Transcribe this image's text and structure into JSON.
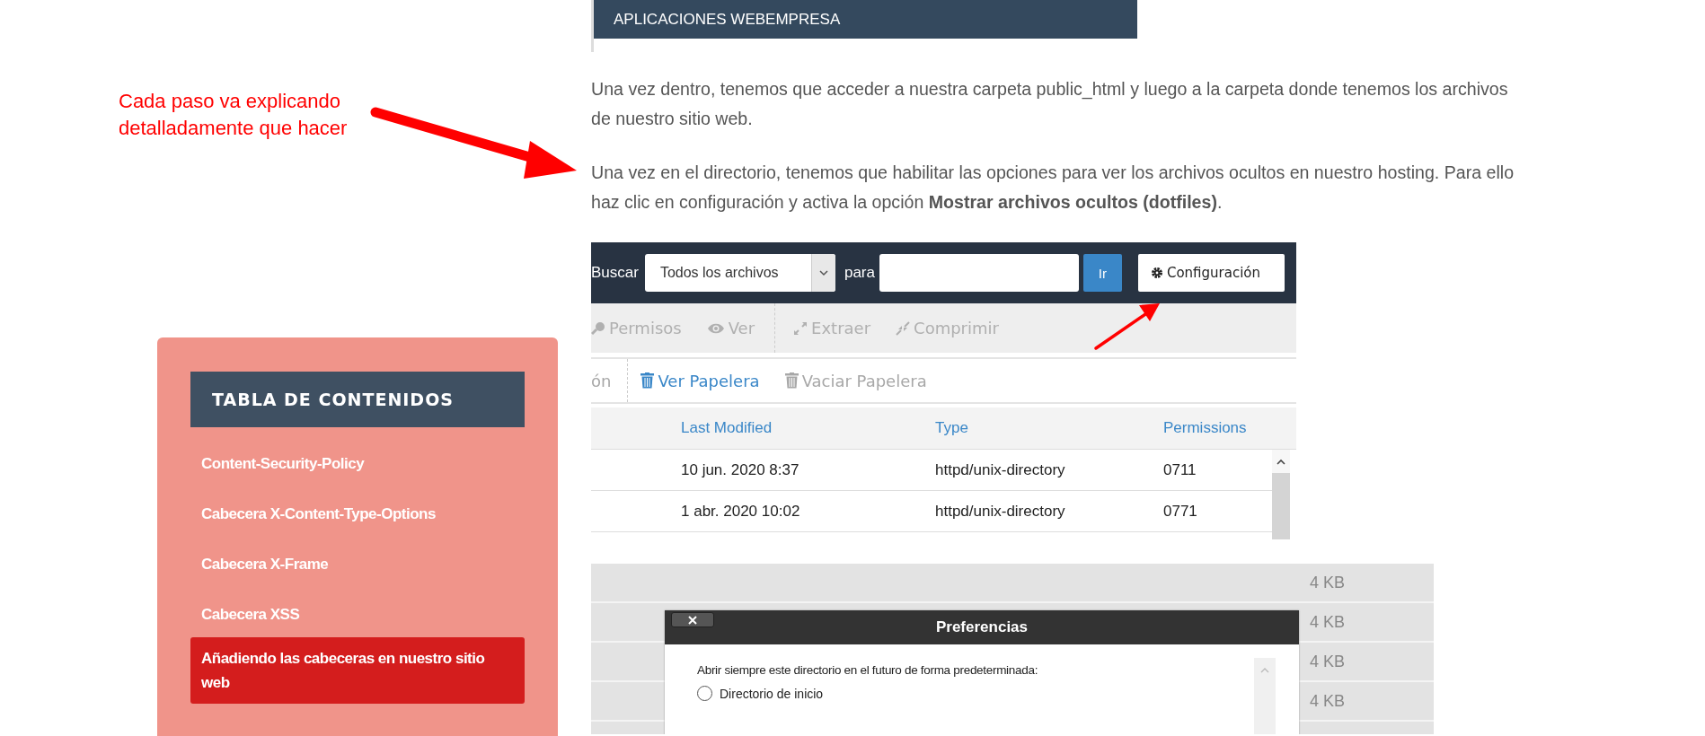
{
  "annotation": {
    "text": "Cada paso va explicando detalladamente que hacer"
  },
  "toc": {
    "title": "TABLA DE CONTENIDOS",
    "items": [
      {
        "label": "Content-Security-Policy",
        "selected": false
      },
      {
        "label": "Cabecera X-Content-Type-Options",
        "selected": false
      },
      {
        "label": "Cabecera X-Frame",
        "selected": false
      },
      {
        "label": "Cabecera XSS",
        "selected": false
      },
      {
        "label": "Añadiendo las cabeceras en nuestro sitio web",
        "selected": true
      }
    ]
  },
  "banner": {
    "title": "APLICACIONES WEBEMPRESA"
  },
  "paragraphs": [
    "Una vez dentro, tenemos que acceder a nuestra carpeta public_html y luego a la carpeta donde tenemos los archivos de nuestro sitio web.",
    "Una vez en el directorio, tenemos que habilitar las opciones para ver los archivos ocultos en nuestro hosting. Para ello haz clic en configuración y activa la opción **Mostrar archivos ocultos (dotfiles)**."
  ],
  "file_manager": {
    "search_label": "Buscar",
    "scope": "Todos los archivos",
    "for_label": "para",
    "go_button": "Ir",
    "settings_button": "Configuración",
    "toolbar": [
      {
        "label": "Permisos",
        "kind": "key",
        "disabled": true
      },
      {
        "label": "Ver",
        "kind": "eye",
        "disabled": true
      },
      {
        "label": "Extraer",
        "kind": "expand",
        "disabled": true
      },
      {
        "label": "Comprimir",
        "kind": "compress",
        "disabled": true
      }
    ],
    "actions": [
      {
        "label": "ón",
        "kind": "text",
        "disabled": true
      },
      {
        "label": "Ver Papelera",
        "kind": "trash",
        "disabled": false
      },
      {
        "label": "Vaciar Papelera",
        "kind": "trash",
        "disabled": true
      }
    ],
    "columns": [
      "Last Modified",
      "Type",
      "Permissions"
    ],
    "rows": [
      [
        "10 jun. 2020 8:37",
        "httpd/unix-directory",
        "0711"
      ],
      [
        "1 abr. 2020 10:02",
        "httpd/unix-directory",
        "0771"
      ]
    ]
  },
  "file_list": {
    "sizes": [
      "4 KB",
      "4 KB",
      "4 KB",
      "4 KB"
    ]
  },
  "preferences_dialog": {
    "title": "Preferencias",
    "prompt": "Abrir siempre este directorio en el futuro de forma predeterminada:",
    "options": [
      {
        "label": "Directorio de inicio",
        "selected": false
      }
    ]
  }
}
